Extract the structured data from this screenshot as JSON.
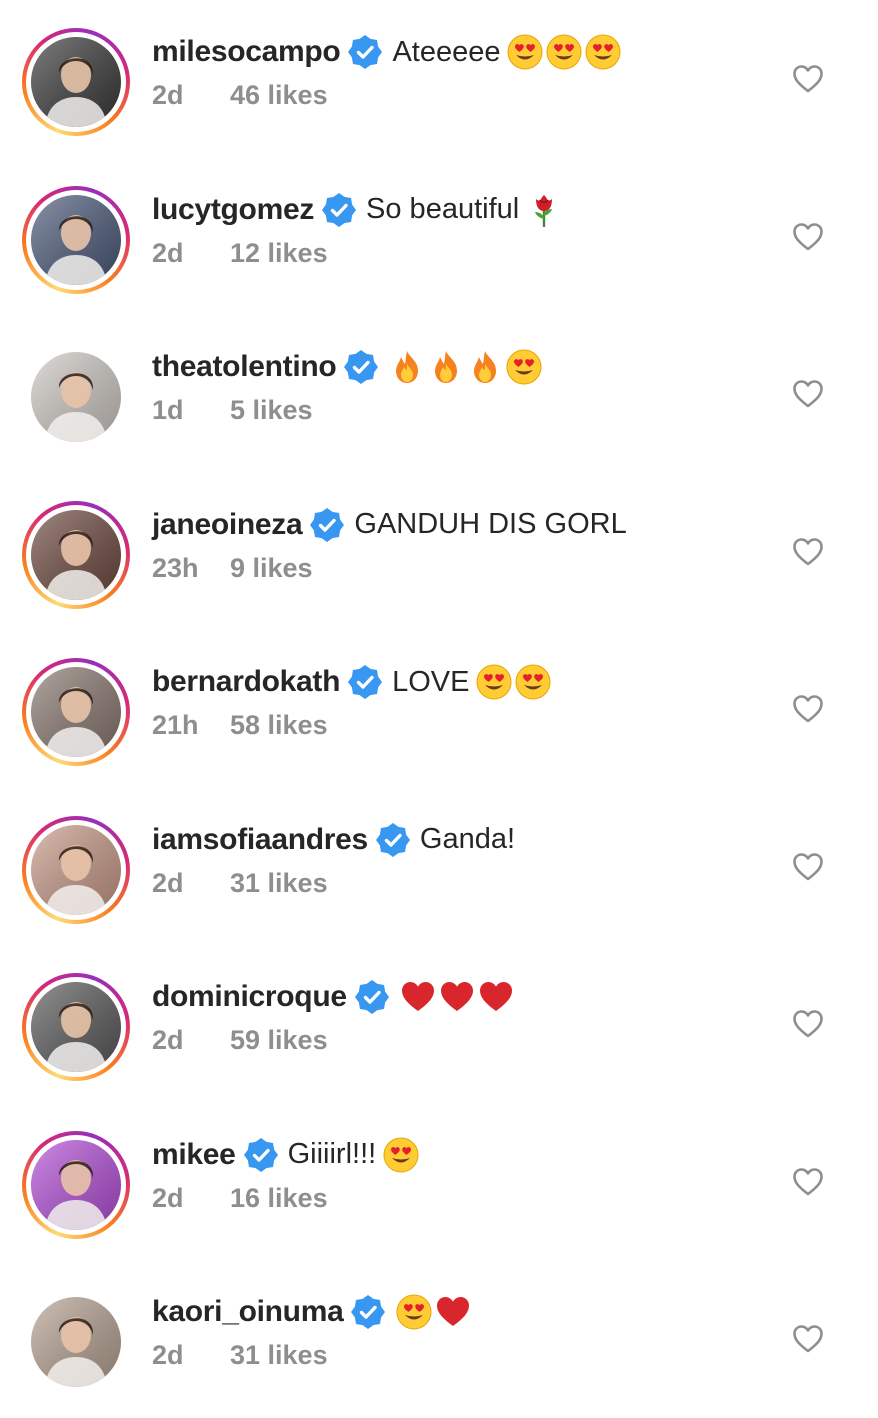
{
  "comments": [
    {
      "username": "milesocampo",
      "text": "Ateeeee",
      "emojis": [
        "heart-eyes",
        "heart-eyes",
        "heart-eyes"
      ],
      "time": "2d",
      "likes": "46 likes",
      "story_ring": true,
      "avatar_tone": "#3a3a3a"
    },
    {
      "username": "lucytgomez",
      "text": "So beautiful",
      "emojis": [
        "rose"
      ],
      "time": "2d",
      "likes": "12 likes",
      "story_ring": true,
      "avatar_tone": "#4b5a7a"
    },
    {
      "username": "theatolentino",
      "text": "",
      "emojis": [
        "fire",
        "fire",
        "fire",
        "heart-eyes"
      ],
      "time": "1d",
      "likes": "5 likes",
      "story_ring": false,
      "avatar_tone": "#cfc9c4"
    },
    {
      "username": "janeoineza",
      "text": "GANDUH DIS GORL",
      "emojis": [],
      "time": "23h",
      "likes": "9 likes",
      "story_ring": true,
      "avatar_tone": "#6e4a40"
    },
    {
      "username": "bernardokath",
      "text": "LOVE",
      "emojis": [
        "heart-eyes",
        "heart-eyes"
      ],
      "time": "21h",
      "likes": "58 likes",
      "story_ring": true,
      "avatar_tone": "#8a7870"
    },
    {
      "username": "iamsofiaandres",
      "text": "Ganda!",
      "emojis": [],
      "time": "2d",
      "likes": "31 likes",
      "story_ring": true,
      "avatar_tone": "#c89a88"
    },
    {
      "username": "dominicroque",
      "text": "",
      "emojis": [
        "red-heart",
        "red-heart",
        "red-heart"
      ],
      "time": "2d",
      "likes": "59 likes",
      "story_ring": true,
      "avatar_tone": "#5a5a5a"
    },
    {
      "username": "mikee",
      "text": "Giiiirl!!!",
      "emojis": [
        "heart-eyes"
      ],
      "time": "2d",
      "likes": "16 likes",
      "story_ring": true,
      "avatar_tone": "#b44fd8"
    },
    {
      "username": "kaori_oinuma",
      "text": "",
      "emojis": [
        "heart-eyes",
        "red-heart"
      ],
      "time": "2d",
      "likes": "31 likes",
      "story_ring": false,
      "avatar_tone": "#b7a292"
    }
  ],
  "colors": {
    "verified_blue": "#3897f0",
    "meta_gray": "#8e8e8e",
    "text_dark": "#262626",
    "heart_outline": "#8e8e8e"
  },
  "icons": {
    "verified": "verified-badge-icon",
    "like": "heart-outline-icon"
  }
}
